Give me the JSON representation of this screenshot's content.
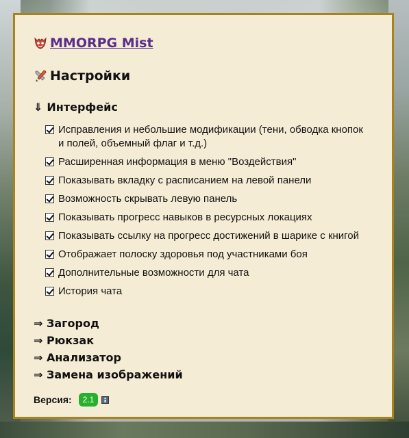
{
  "header": {
    "title": "MMORPG Mist",
    "title_icon": "mask-icon",
    "settings_title": "Настройки",
    "settings_icon": "tools-icon"
  },
  "interface_section": {
    "arrow": "⇓",
    "title": "Интерфейс",
    "options": [
      {
        "label": "Исправления и небольшие модификации (тени, обводка кнопок и полей, объемный флаг и т.д.)",
        "checked": true
      },
      {
        "label": "Расширенная информация в меню \"Воздействия\"",
        "checked": true
      },
      {
        "label": "Показывать вкладку с расписанием на левой панели",
        "checked": true
      },
      {
        "label": "Возможность скрывать левую панель",
        "checked": true
      },
      {
        "label": "Показывать прогресс навыков в ресурсных локациях",
        "checked": true
      },
      {
        "label": "Показывать ссылку на прогресс достижений в шарике с книгой",
        "checked": true
      },
      {
        "label": "Отображает полоску здоровья под участниками боя",
        "checked": true
      },
      {
        "label": "Дополнительные возможности для чата",
        "checked": true
      },
      {
        "label": "История чата",
        "checked": true
      }
    ]
  },
  "nav": {
    "arrow": "⇒",
    "items": [
      "Загород",
      "Рюкзак",
      "Анализатор",
      "Замена изображений"
    ]
  },
  "version": {
    "label": "Версия:",
    "value": "2.1",
    "badge_color": "#27b02c",
    "info_icon": "info-icon"
  },
  "colors": {
    "panel_bg": "#f5ecd6",
    "panel_border": "#a8831d",
    "title_link": "#5b2d8a"
  }
}
